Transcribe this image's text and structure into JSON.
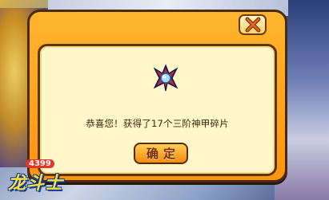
{
  "background": {
    "top_text": ""
  },
  "dialog": {
    "close_icon": "close-x-icon",
    "item_icon": "armor-fragment-icon",
    "message": "恭喜您！获得了17个三阶神甲碎片",
    "confirm_label": "确定"
  },
  "logo": {
    "number": "4399",
    "title": "龙斗士"
  },
  "colors": {
    "dialog_frame": "#ff9f18",
    "dialog_panel": "#fff7c9",
    "button_fill": "#f7a020",
    "button_text": "#7a2a04"
  }
}
